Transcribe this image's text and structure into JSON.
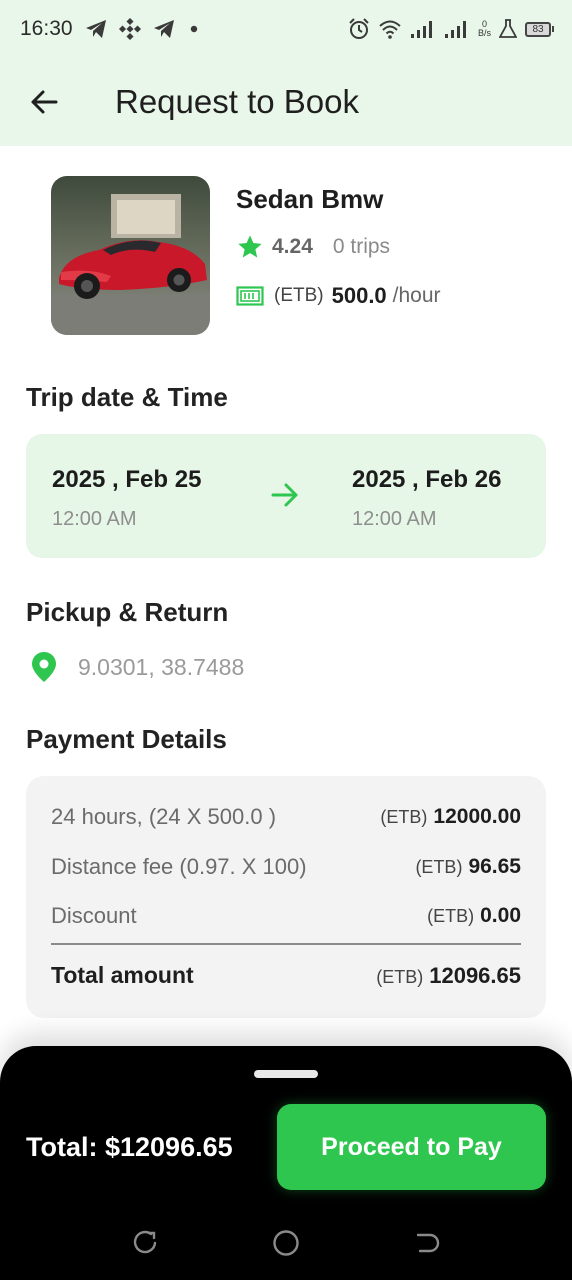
{
  "status_bar": {
    "time": "16:30",
    "netspeed_value": "0",
    "netspeed_unit": "B/s",
    "battery": "83",
    "icons": [
      "telegram-icon",
      "binance-icon",
      "telegram-icon",
      "dot-icon",
      "alarm-icon",
      "wifi-icon",
      "signal-icon",
      "signal-icon",
      "flask-icon",
      "battery-icon"
    ]
  },
  "app_bar": {
    "title": "Request to Book",
    "back_icon": "arrow-left-icon"
  },
  "car": {
    "name": "Sedan Bmw",
    "rating": "4.24",
    "trips": "0 trips",
    "currency": "(ETB)",
    "price": "500.0",
    "unit": "/hour"
  },
  "trip": {
    "section_title": "Trip date & Time",
    "start_date": "2025 , Feb 25",
    "start_time": "12:00 AM",
    "end_date": "2025 , Feb 26",
    "end_time": "12:00 AM"
  },
  "pickup": {
    "section_title": "Pickup & Return",
    "location": "9.0301, 38.7488"
  },
  "payment": {
    "section_title": "Payment Details",
    "rows": [
      {
        "label": "24 hours, (24  X 500.0 )",
        "currency": "(ETB)",
        "amount": "12000.00"
      },
      {
        "label": "Distance fee (0.97. X 100)",
        "currency": "(ETB)",
        "amount": "96.65"
      },
      {
        "label": "Discount",
        "currency": "(ETB)",
        "amount": "0.00"
      }
    ],
    "total_label": "Total amount",
    "total_currency": "(ETB)",
    "total_amount": "12096.65"
  },
  "bottom": {
    "total_text": "Total: $12096.65",
    "pay_button": "Proceed to Pay"
  },
  "colors": {
    "accent": "#2fc64f",
    "header_bg": "#e9f7ea",
    "trip_card_bg": "#e6f6e7",
    "payment_card_bg": "#f3f3f3"
  }
}
